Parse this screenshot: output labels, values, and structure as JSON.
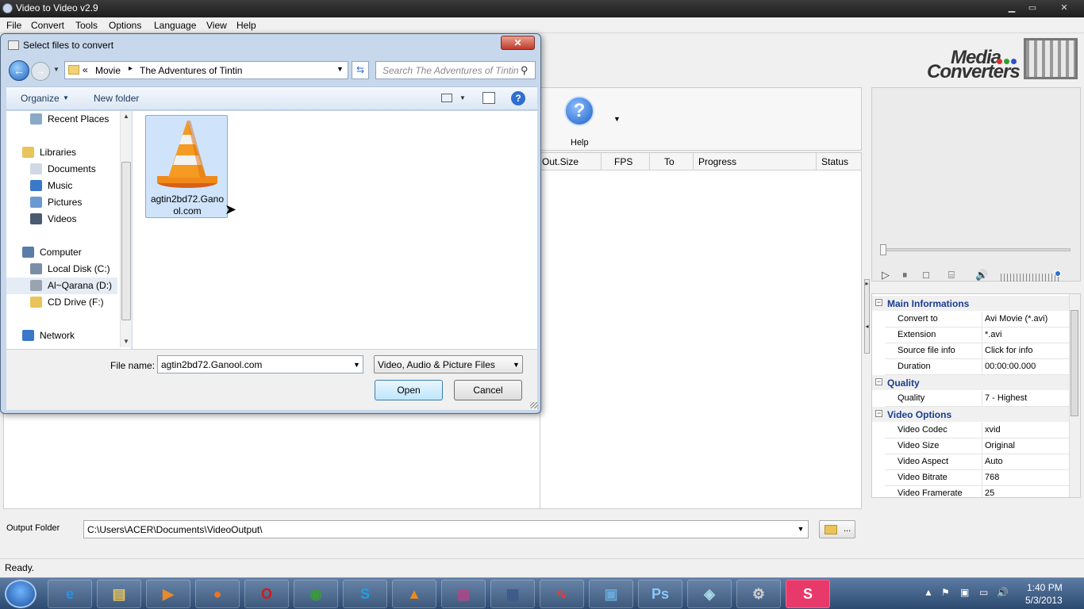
{
  "app": {
    "title": "Video to Video v2.9",
    "menu": [
      "File",
      "Convert",
      "Tools",
      "Options",
      "Language",
      "View",
      "Help"
    ],
    "window_controls": {
      "minimize": "▁",
      "maximize": "▭",
      "close": "✕"
    },
    "logo": {
      "line1": "Media",
      "line2": "Converters"
    },
    "toolbar": {
      "help_label": "Help",
      "more_arrow": "▼"
    },
    "list_columns": [
      "Out.Size",
      "FPS",
      "To",
      "Progress",
      "Status"
    ],
    "output_folder_label": "Output Folder",
    "output_folder_value": "C:\\Users\\ACER\\Documents\\VideoOutput\\",
    "browse_label": "...",
    "status": "Ready."
  },
  "player": {
    "play": "▷",
    "pause": "⏸",
    "stop": "□",
    "snapshot": "⌸",
    "volume": "🔊",
    "volume_level": 0.95
  },
  "properties": {
    "categories": [
      {
        "name": "Main Informations",
        "toggle": "−",
        "rows": [
          {
            "key": "Convert to",
            "value": "Avi Movie (*.avi)"
          },
          {
            "key": "Extension",
            "value": "*.avi"
          },
          {
            "key": "Source file info",
            "value": "Click for info"
          },
          {
            "key": "Duration",
            "value": "00:00:00.000"
          }
        ]
      },
      {
        "name": "Quality",
        "toggle": "−",
        "rows": [
          {
            "key": "Quality",
            "value": "7 - Highest"
          }
        ]
      },
      {
        "name": "Video Options",
        "toggle": "−",
        "rows": [
          {
            "key": "Video Codec",
            "value": "xvid"
          },
          {
            "key": "Video Size",
            "value": "Original"
          },
          {
            "key": "Video Aspect",
            "value": "Auto"
          },
          {
            "key": "Video Bitrate",
            "value": "768"
          },
          {
            "key": "Video Framerate",
            "value": "25"
          }
        ]
      }
    ]
  },
  "dialog": {
    "title": "Select files to convert",
    "close": "✕",
    "address": {
      "chevron": "«",
      "parts": [
        "Movie",
        "The Adventures of Tintin"
      ],
      "sep": "▸",
      "drop": "▼"
    },
    "search_placeholder": "Search The Adventures of Tintin",
    "organize": "Organize",
    "new_folder": "New folder",
    "help": "?",
    "nav": [
      {
        "label": "Recent Places",
        "icon": "recent-places-icon",
        "indent": 1,
        "color": "#8aa8c8"
      },
      {
        "label": "Libraries",
        "icon": "libraries-icon",
        "indent": 0,
        "color": "#e8c45a"
      },
      {
        "label": "Documents",
        "icon": "documents-icon",
        "indent": 1,
        "color": "#cfd8e4"
      },
      {
        "label": "Music",
        "icon": "music-icon",
        "indent": 1,
        "color": "#3a78c8"
      },
      {
        "label": "Pictures",
        "icon": "pictures-icon",
        "indent": 1,
        "color": "#6a9ad0"
      },
      {
        "label": "Videos",
        "icon": "videos-icon",
        "indent": 1,
        "color": "#4a5a70"
      },
      {
        "label": "Computer",
        "icon": "computer-icon",
        "indent": 0,
        "color": "#5a7ca8"
      },
      {
        "label": "Local Disk (C:)",
        "icon": "local-disk-icon",
        "indent": 1,
        "color": "#7a8ea8"
      },
      {
        "label": "Al~Qarana (D:)",
        "icon": "drive-icon",
        "indent": 1,
        "color": "#9aa4b0",
        "selected": true
      },
      {
        "label": "CD Drive (F:)",
        "icon": "cd-drive-icon",
        "indent": 1,
        "color": "#e8c45a"
      },
      {
        "label": "Network",
        "icon": "network-icon",
        "indent": 0,
        "color": "#3a78c8"
      }
    ],
    "file": {
      "name_line1": "agtin2bd72.Gano",
      "name_line2": "ol.com"
    },
    "file_name_label": "File name:",
    "file_name_value": "agtin2bd72.Ganool.com",
    "file_type": "Video, Audio & Picture Files",
    "open": "Open",
    "cancel": "Cancel"
  },
  "taskbar": {
    "apps": [
      {
        "name": "ie-icon",
        "glyph": "e",
        "color": "#2d8fe0"
      },
      {
        "name": "explorer-icon",
        "glyph": "▤",
        "color": "#e8c45a"
      },
      {
        "name": "media-player-icon",
        "glyph": "▶",
        "color": "#e88a2a"
      },
      {
        "name": "firefox-icon",
        "glyph": "●",
        "color": "#e8742a"
      },
      {
        "name": "opera-icon",
        "glyph": "O",
        "color": "#d01a1a"
      },
      {
        "name": "chrome-icon",
        "glyph": "◉",
        "color": "#3a9a3a"
      },
      {
        "name": "skype-icon",
        "glyph": "S",
        "color": "#1aa0e8"
      },
      {
        "name": "vlc-icon",
        "glyph": "▲",
        "color": "#f08a1a"
      },
      {
        "name": "winrar-icon",
        "glyph": "▥",
        "color": "#a84a8a"
      },
      {
        "name": "movie-maker-icon",
        "glyph": "▦",
        "color": "#3a5a8a"
      },
      {
        "name": "audition-icon",
        "glyph": "∿",
        "color": "#e83a3a"
      },
      {
        "name": "photo-viewer-icon",
        "glyph": "▣",
        "color": "#6aa8d8"
      },
      {
        "name": "photoshop-icon",
        "glyph": "Ps",
        "color": "#8ac8f8"
      },
      {
        "name": "notes-icon",
        "glyph": "◈",
        "color": "#a8d8e8"
      },
      {
        "name": "video-converter-icon",
        "glyph": "⚙",
        "color": "#d0d0d0"
      },
      {
        "name": "s-app-icon",
        "glyph": "S",
        "color": "#ffffff"
      }
    ],
    "tray": [
      "▲",
      "⚑",
      "▣",
      "▭",
      "🔊"
    ],
    "time": "1:40 PM",
    "date": "5/3/2013"
  },
  "colors": {
    "accent": "#1a3c8f",
    "selection": "#cfe4fb",
    "taskbar": "#2c4a70"
  }
}
